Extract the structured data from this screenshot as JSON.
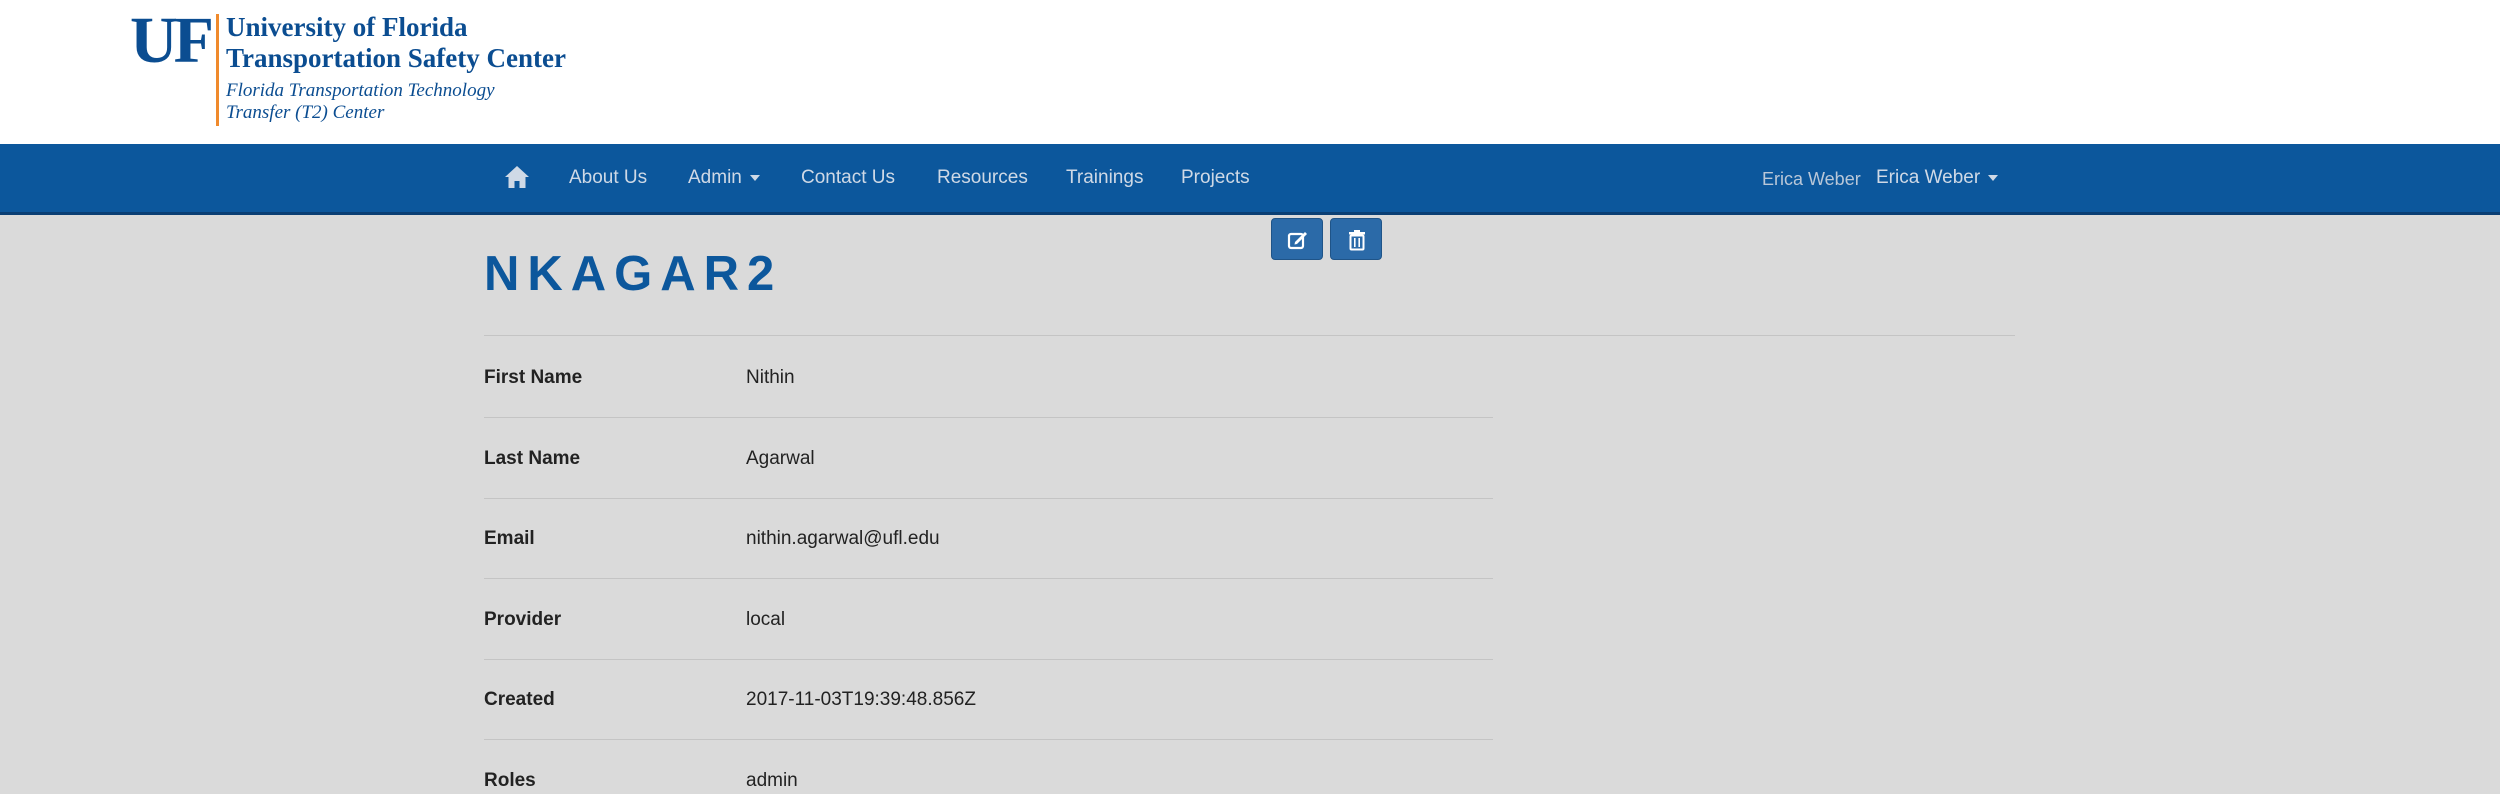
{
  "logo": {
    "mark": "UF",
    "title_line1": "University of Florida",
    "title_line2": "Transportation Safety Center",
    "subtitle_line1": "Florida Transportation Technology",
    "subtitle_line2": "Transfer (T2) Center",
    "colors": {
      "primary": "#0b4d91",
      "accent": "#f08a2c"
    }
  },
  "navbar": {
    "home_icon": "home-icon",
    "items": [
      {
        "label": "About Us"
      },
      {
        "label": "Admin",
        "dropdown": true
      },
      {
        "label": "Contact Us"
      },
      {
        "label": "Resources"
      },
      {
        "label": "Trainings"
      },
      {
        "label": "Projects"
      }
    ],
    "user_text": "Erica Weber",
    "user_menu_label": "Erica Weber",
    "colors": {
      "background": "#0c579c",
      "text": "#cfd9e6"
    }
  },
  "actions": {
    "edit_icon": "edit-icon",
    "delete_icon": "trash-icon"
  },
  "user": {
    "username": "NKAGAR2",
    "fields": [
      {
        "label": "First Name",
        "value": "Nithin"
      },
      {
        "label": "Last Name",
        "value": "Agarwal"
      },
      {
        "label": "Email",
        "value": "nithin.agarwal@ufl.edu"
      },
      {
        "label": "Provider",
        "value": "local"
      },
      {
        "label": "Created",
        "value": "2017-11-03T19:39:48.856Z"
      },
      {
        "label": "Roles",
        "value": "admin"
      }
    ]
  }
}
